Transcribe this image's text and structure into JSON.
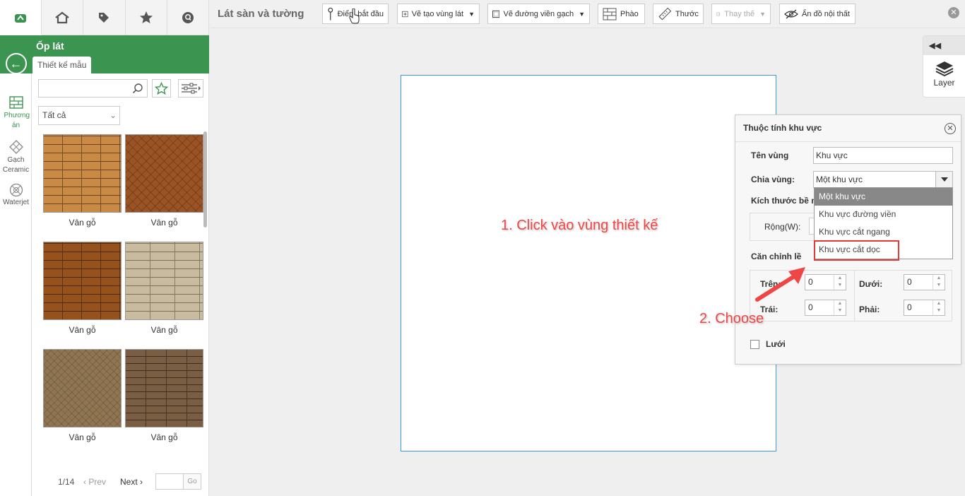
{
  "toolbar": {
    "title": "Lát sàn và tường",
    "buttons": [
      {
        "label": "Điểm bắt đầu"
      },
      {
        "label": "Vẽ tạo vùng lát"
      },
      {
        "label": "Vẽ đường viền gạch"
      },
      {
        "label": "Phào"
      },
      {
        "label": "Thước"
      },
      {
        "label": "Thay thế"
      },
      {
        "label": "Ẩn đồ nội thất"
      }
    ]
  },
  "sidebar": {
    "header_title": "Ốp lát",
    "subtab": "Thiết kế mẫu",
    "rail": [
      {
        "label": "Phương án"
      },
      {
        "label": "Gạch Ceramic"
      },
      {
        "label": "Waterjet"
      }
    ],
    "filter_value": "Tất cả",
    "search_placeholder": "",
    "tiles": [
      {
        "label": "Vân gỗ"
      },
      {
        "label": "Vân gỗ"
      },
      {
        "label": "Vân gỗ"
      },
      {
        "label": "Vân gỗ"
      },
      {
        "label": "Vân gỗ"
      },
      {
        "label": "Vân gỗ"
      }
    ],
    "pager": {
      "page": "1/14",
      "prev": "Prev",
      "next": "Next",
      "go": "Go"
    }
  },
  "layer": {
    "label": "Layer"
  },
  "dialog": {
    "title": "Thuộc tính khu vực",
    "name_label": "Tên vùng",
    "name_value": "Khu vực",
    "split_label": "Chia vùng:",
    "split_value": "Một khu vực",
    "size_label": "Kích thước bề m",
    "width_label": "Rộng(W):",
    "align_label": "Căn chỉnh lề",
    "top_label": "Trên:",
    "bottom_label": "Dưới:",
    "left_label": "Trái:",
    "right_label": "Phải:",
    "top_value": "0",
    "bottom_value": "0",
    "left_value": "0",
    "right_value": "0",
    "grid_label": "Lưới",
    "options": [
      "Một khu vực",
      "Khu vực đường viền",
      "Khu vực cắt ngang",
      "Khu vực cắt dọc"
    ]
  },
  "annotations": {
    "step1": "1. Click vào vùng thiết kế",
    "step2": "2. Choose"
  },
  "colors": {
    "brand": "#3b9450",
    "canvas_border": "#3a9ad9",
    "annotation": "#f04545"
  }
}
